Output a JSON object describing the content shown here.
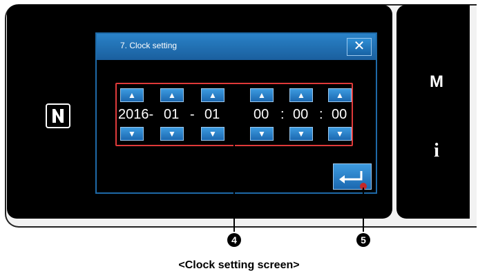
{
  "dialog": {
    "title": "7. Clock setting",
    "close_glyph": "✕"
  },
  "date": {
    "year": "2016-",
    "sep1": "01",
    "dash": "-",
    "day": "01"
  },
  "time": {
    "hour": "00",
    "colon1": ":",
    "minute": "00",
    "colon2": ":",
    "second": "00"
  },
  "spinner": {
    "up_glyph": "▲",
    "down_glyph": "▼"
  },
  "side": {
    "m_label": "M",
    "i_label": "i"
  },
  "callouts": {
    "four": "4",
    "five": "5"
  },
  "caption": "<Clock setting screen>",
  "colors": {
    "accent": "#1b68b0",
    "highlight": "#e03a3a"
  }
}
